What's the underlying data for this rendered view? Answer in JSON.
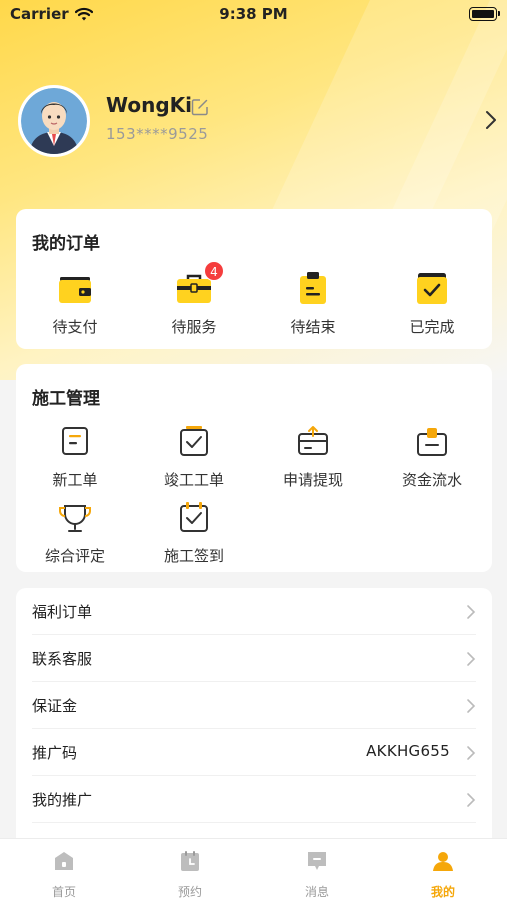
{
  "status_bar": {
    "carrier": "Carrier",
    "time": "9:38 PM"
  },
  "profile": {
    "username": "WongKi",
    "phone": "153****9525"
  },
  "orders": {
    "title": "我的订单",
    "items": [
      {
        "label": "待支付",
        "icon": "wallet-icon"
      },
      {
        "label": "待服务",
        "icon": "toolbox-icon",
        "badge": "4"
      },
      {
        "label": "待结束",
        "icon": "clipboard-icon"
      },
      {
        "label": "已完成",
        "icon": "check-box-icon"
      }
    ]
  },
  "construction": {
    "title": "施工管理",
    "items": [
      {
        "label": "新工单",
        "icon": "document-icon"
      },
      {
        "label": "竣工工单",
        "icon": "calendar-check-icon"
      },
      {
        "label": "申请提现",
        "icon": "card-withdraw-icon"
      },
      {
        "label": "资金流水",
        "icon": "wallet-flow-icon"
      },
      {
        "label": "综合评定",
        "icon": "trophy-icon"
      },
      {
        "label": "施工签到",
        "icon": "calendar-checkin-icon"
      }
    ]
  },
  "menu": [
    {
      "label": "福利订单",
      "value": ""
    },
    {
      "label": "联系客服",
      "value": ""
    },
    {
      "label": "保证金",
      "value": ""
    },
    {
      "label": "推广码",
      "value": "AKKHG655"
    },
    {
      "label": "我的推广",
      "value": ""
    }
  ],
  "tabs": [
    {
      "label": "首页",
      "icon": "home-icon"
    },
    {
      "label": "预约",
      "icon": "calendar-icon"
    },
    {
      "label": "消息",
      "icon": "message-icon"
    },
    {
      "label": "我的",
      "icon": "user-icon",
      "active": true
    }
  ],
  "colors": {
    "accent": "#f5a70a",
    "yellow": "#ffd21f",
    "badge": "#f53d3d",
    "tab_inactive": "#bdbdbd"
  }
}
